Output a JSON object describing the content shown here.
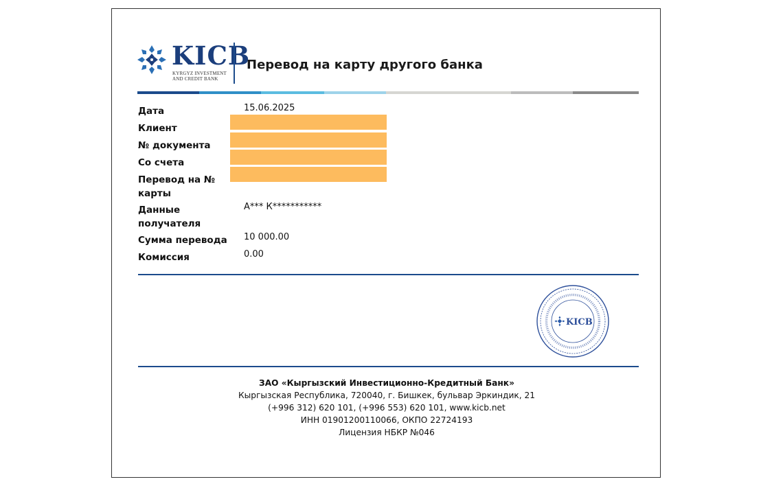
{
  "logo": {
    "brand": "KICB",
    "tagline": "KYRGYZ INVESTMENT\nAND CREDIT BANK"
  },
  "document": {
    "title": "Перевод на карту другого банка"
  },
  "fields": {
    "date_label": "Дата",
    "date_value": "15.06.2025",
    "client_label": "Клиент",
    "doc_number_label": "№ документа",
    "from_account_label": "Со счета",
    "card_transfer_label": "Перевод на № карты",
    "recipient_label": "Данные получателя",
    "recipient_value": "А*** К***********",
    "amount_label": "Сумма перевода",
    "amount_value": "10 000.00",
    "commission_label": "Комиссия",
    "commission_value": "0.00"
  },
  "stamp": {
    "brand": "KICB"
  },
  "footer": {
    "company": "ЗАО «Кыргызский Инвестиционно-Кредитный Банк»",
    "address": "Кыргызская Республика, 720040, г. Бишкек, бульвар Эркиндик, 21",
    "contacts": "(+996 312) 620 101, (+996 553) 620 101, www.kicb.net",
    "ids": "ИНН 01901200110066, ОКПО 22724193",
    "license": "Лицензия НБКР №046"
  },
  "colors": {
    "brand_blue": "#1b3e7c",
    "rule_blue": "#1b4b8c",
    "redaction_orange": "#fdbb5e",
    "band": [
      "#1b4b8c",
      "#2f8fc7",
      "#5bbce0",
      "#9ed3ea",
      "#d6d6d2",
      "#bcbcbc",
      "#8a8a8a"
    ]
  }
}
